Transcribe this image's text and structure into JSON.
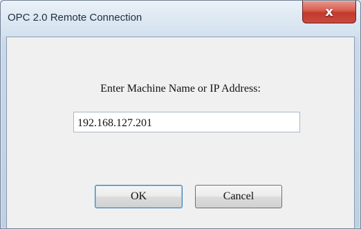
{
  "window": {
    "title": "OPC 2.0 Remote Connection",
    "close_label": "x"
  },
  "dialog": {
    "prompt": "Enter Machine Name or IP Address:",
    "ip_value": "192.168.127.201",
    "ok_label": "OK",
    "cancel_label": "Cancel"
  }
}
